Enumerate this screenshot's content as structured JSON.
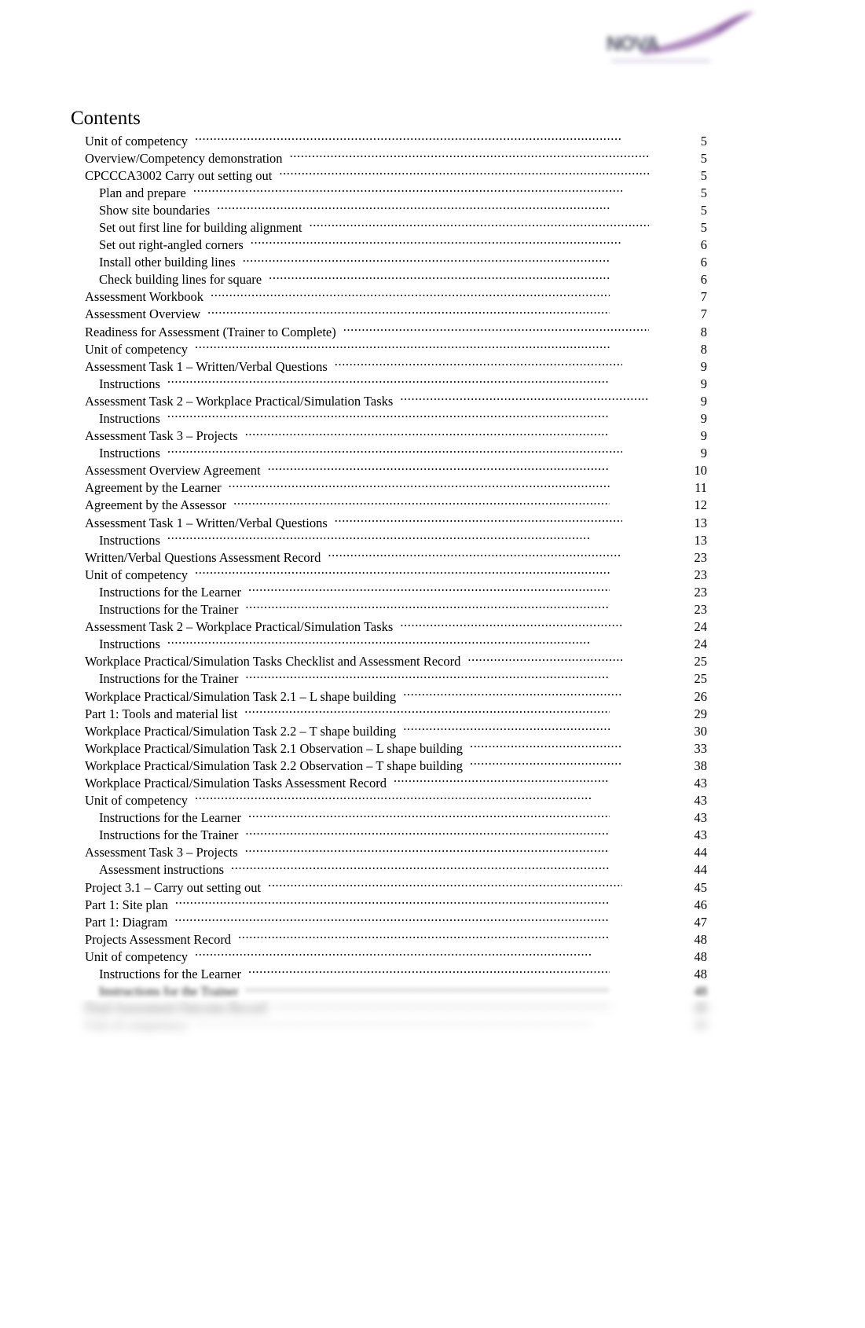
{
  "logo": {
    "wordmark": "NOVA",
    "swoosh_color": "#a87fb8",
    "wordmark_color": "#3d3f55"
  },
  "toc": {
    "heading": "Contents",
    "entries": [
      {
        "label": "Unit of competency",
        "page": "5",
        "level": 1,
        "gap": "sm"
      },
      {
        "label": "Overview/Competency demonstration",
        "page": "5",
        "level": 1,
        "gap": "xl"
      },
      {
        "label": "CPCCCA3002 Carry out setting out",
        "page": "5",
        "level": 1,
        "gap": "xl"
      },
      {
        "label": "Plan and prepare",
        "page": "5",
        "level": 2,
        "gap": "sm"
      },
      {
        "label": "Show site boundaries",
        "page": "5",
        "level": 2,
        "gap": "md"
      },
      {
        "label": "Set out first line for building alignment",
        "page": "5",
        "level": 2,
        "gap": "xl"
      },
      {
        "label": "Set out right-angled corners",
        "page": "6",
        "level": 2,
        "gap": "sm"
      },
      {
        "label": "Install other building lines",
        "page": "6",
        "level": 2,
        "gap": "md"
      },
      {
        "label": "Check building lines for square",
        "page": "6",
        "level": 2,
        "gap": "md"
      },
      {
        "label": "Assessment Workbook",
        "page": "7",
        "level": 1,
        "gap": "md"
      },
      {
        "label": "Assessment Overview",
        "page": "7",
        "level": 1,
        "gap": "md"
      },
      {
        "label": "Readiness for Assessment (Trainer to Complete)",
        "page": "8",
        "level": 1,
        "gap": "xl"
      },
      {
        "label": "Unit of competency",
        "page": "8",
        "level": 1,
        "gap": "md"
      },
      {
        "label": "Assessment Task 1    – Written/Verbal Questions",
        "page": "9",
        "level": 1,
        "gap": "sm"
      },
      {
        "label": "Instructions",
        "page": "9",
        "level": 2,
        "gap": "md"
      },
      {
        "label": "Assessment Task 2    – Workplace Practical/Simulation Tasks",
        "page": "9",
        "level": 1,
        "gap": "xl"
      },
      {
        "label": "Instructions",
        "page": "9",
        "level": 2,
        "gap": "md"
      },
      {
        "label": "Assessment Task 3    – Projects",
        "page": "9",
        "level": 1,
        "gap": "md"
      },
      {
        "label": "Instructions",
        "page": "9",
        "level": 2,
        "gap": "sm"
      },
      {
        "label": "Assessment Overview Agreement",
        "page": "10",
        "level": 1,
        "gap": "md"
      },
      {
        "label": "Agreement by the Learner",
        "page": "11",
        "level": 1,
        "gap": "md"
      },
      {
        "label": "Agreement by the Assessor",
        "page": "12",
        "level": 1,
        "gap": "md"
      },
      {
        "label": "Assessment Task 1    – Written/Verbal Questions",
        "page": "13",
        "level": 1,
        "gap": "sm"
      },
      {
        "label": "Instructions",
        "page": "13",
        "level": 2,
        "gap": "lg"
      },
      {
        "label": "Written/Verbal Questions Assessment Record",
        "page": "23",
        "level": 1,
        "gap": "sm"
      },
      {
        "label": "Unit of competency",
        "page": "23",
        "level": 1,
        "gap": "md"
      },
      {
        "label": "Instructions for the Learner",
        "page": "23",
        "level": 2,
        "gap": "md"
      },
      {
        "label": "Instructions for the Trainer",
        "page": "23",
        "level": 2,
        "gap": "md"
      },
      {
        "label": "Assessment Task 2    – Workplace Practical/Simulation Tasks",
        "page": "24",
        "level": 1,
        "gap": "sm"
      },
      {
        "label": "Instructions",
        "page": "24",
        "level": 2,
        "gap": "lg"
      },
      {
        "label": "Workplace Practical/Simulation Tasks Checklist and Assessment Record",
        "page": "25",
        "level": 1,
        "gap": "sm"
      },
      {
        "label": "Instructions for the Trainer",
        "page": "25",
        "level": 2,
        "gap": "md"
      },
      {
        "label": "Workplace Practical/Simulation Task 2.1       – L shape building",
        "page": "26",
        "level": 1,
        "gap": "sm"
      },
      {
        "label": "Part 1: Tools and material list",
        "page": "29",
        "level": 1,
        "gap": "md"
      },
      {
        "label": "Workplace Practical/Simulation Task 2.2       – T shape building",
        "page": "30",
        "level": 1,
        "gap": "md"
      },
      {
        "label": "Workplace Practical/Simulation Task 2.1 Observation        – L shape building",
        "page": "33",
        "level": 1,
        "gap": "sm"
      },
      {
        "label": "Workplace Practical/Simulation Task 2.2 Observation        – T shape building",
        "page": "38",
        "level": 1,
        "gap": "sm"
      },
      {
        "label": "Workplace Practical/Simulation Tasks Assessment Record",
        "page": "43",
        "level": 1,
        "gap": "md"
      },
      {
        "label": "Unit of competency",
        "page": "43",
        "level": 1,
        "gap": "lg"
      },
      {
        "label": "Instructions for the Learner",
        "page": "43",
        "level": 2,
        "gap": "md"
      },
      {
        "label": "Instructions for the Trainer",
        "page": "43",
        "level": 2,
        "gap": "md"
      },
      {
        "label": "Assessment Task 3    – Projects",
        "page": "44",
        "level": 1,
        "gap": "md"
      },
      {
        "label": "Assessment instructions",
        "page": "44",
        "level": 2,
        "gap": "md"
      },
      {
        "label": "Project 3.1   – Carry out setting out",
        "page": "45",
        "level": 1,
        "gap": "sm"
      },
      {
        "label": "Part 1: Site plan",
        "page": "46",
        "level": 1,
        "gap": "md"
      },
      {
        "label": "Part 1: Diagram",
        "page": "47",
        "level": 1,
        "gap": "md"
      },
      {
        "label": "Projects Assessment Record",
        "page": "48",
        "level": 1,
        "gap": "md"
      },
      {
        "label": "Unit of competency",
        "page": "48",
        "level": 1,
        "gap": "lg"
      },
      {
        "label": "Instructions for the Learner",
        "page": "48",
        "level": 2,
        "gap": "md"
      },
      {
        "label": "Instructions for the Trainer",
        "page": "48",
        "level": 2,
        "gap": "md"
      },
      {
        "label": "Final Assessment Outcome Record",
        "page": "49",
        "level": 1,
        "gap": "md"
      },
      {
        "label": "Unit of competency",
        "page": "49",
        "level": 1,
        "gap": "lg"
      }
    ]
  }
}
